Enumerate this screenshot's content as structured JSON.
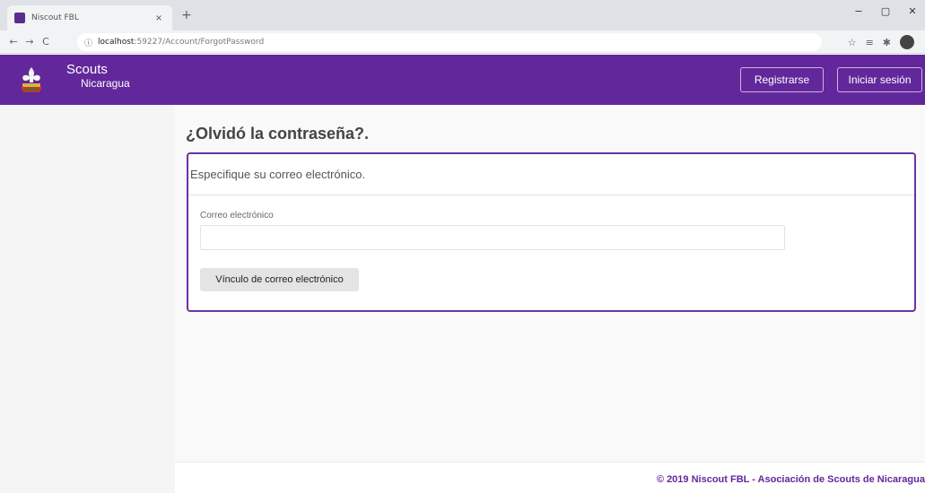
{
  "browser": {
    "tab_title": "Niscout FBL",
    "tab_close": "×",
    "new_tab": "+",
    "window_controls": [
      "−",
      "▢",
      "✕"
    ],
    "nav": {
      "back": "←",
      "forward": "→",
      "reload": "C"
    },
    "url_host": "localhost",
    "url_rest": ":59227/Account/ForgotPassword",
    "extensions": [
      "☆",
      "≡",
      "✱"
    ]
  },
  "header": {
    "brand_line1": "Scouts",
    "brand_line2": "Nicaragua",
    "register_label": "Registrarse",
    "login_label": "Iniciar sesión",
    "accent_color": "#62279a"
  },
  "main": {
    "title": "¿Olvidó la contraseña?.",
    "card_header": "Especifique su correo electrónico.",
    "email_label": "Correo electrónico",
    "email_value": "",
    "submit_label": "Vínculo de correo electrónico"
  },
  "footer": {
    "text": "© 2019 Niscout FBL - Asociación de Scouts de Nicaragua"
  },
  "icons": {
    "logo": "scouts-fleur-de-lis-logo",
    "info": "info-icon"
  }
}
